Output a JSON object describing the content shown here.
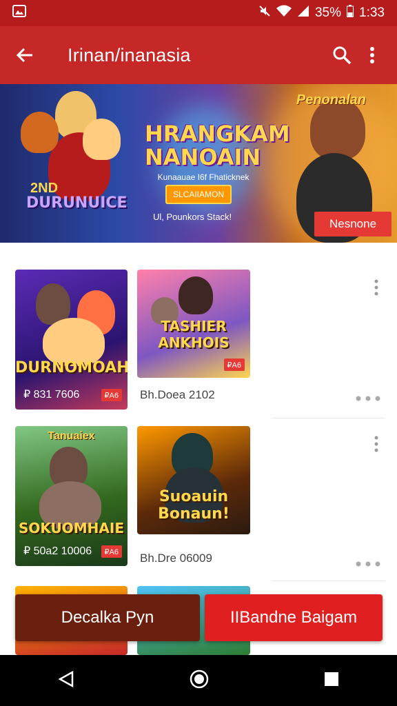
{
  "status_bar": {
    "battery_percent": "35%",
    "time": "1:33"
  },
  "app_bar": {
    "title": "Irinan/inanasia"
  },
  "banner": {
    "title": "HRANGKAM NANOAIN",
    "subtitle": "Kunaauae I6f Fhaticknek",
    "chip": "SLCAIIAMON",
    "footer": "Ul, Pounkors Stack!",
    "right_title": "Penonalan",
    "left_title": "DURUNUICE",
    "left_badge": "2ND",
    "cta": "Nesnone"
  },
  "grid": [
    {
      "tile": {
        "title": "DURNOMOAH",
        "price": "₽ 831 7606",
        "tag": "₽A6"
      },
      "card": {
        "title": "TASHIER ANKHOIS",
        "caption": "Bh.Doea 2102",
        "tag": "₽A6"
      }
    },
    {
      "tile": {
        "title": "SOKUOMHAIE",
        "header": "Tanuaiex",
        "price": "₽ 50a2 10006",
        "tag": "₽A6"
      },
      "card": {
        "title": "Suoauin Bonaun!",
        "caption": "Bh.Dre 06009"
      }
    }
  ],
  "actions": {
    "left": "Decalka Pyn",
    "right": "IIBandne Baigam"
  },
  "colors": {
    "primary": "#c62828",
    "status": "#b71c1c",
    "cta_dark": "#6b1f0e",
    "cta_red": "#e02020"
  }
}
